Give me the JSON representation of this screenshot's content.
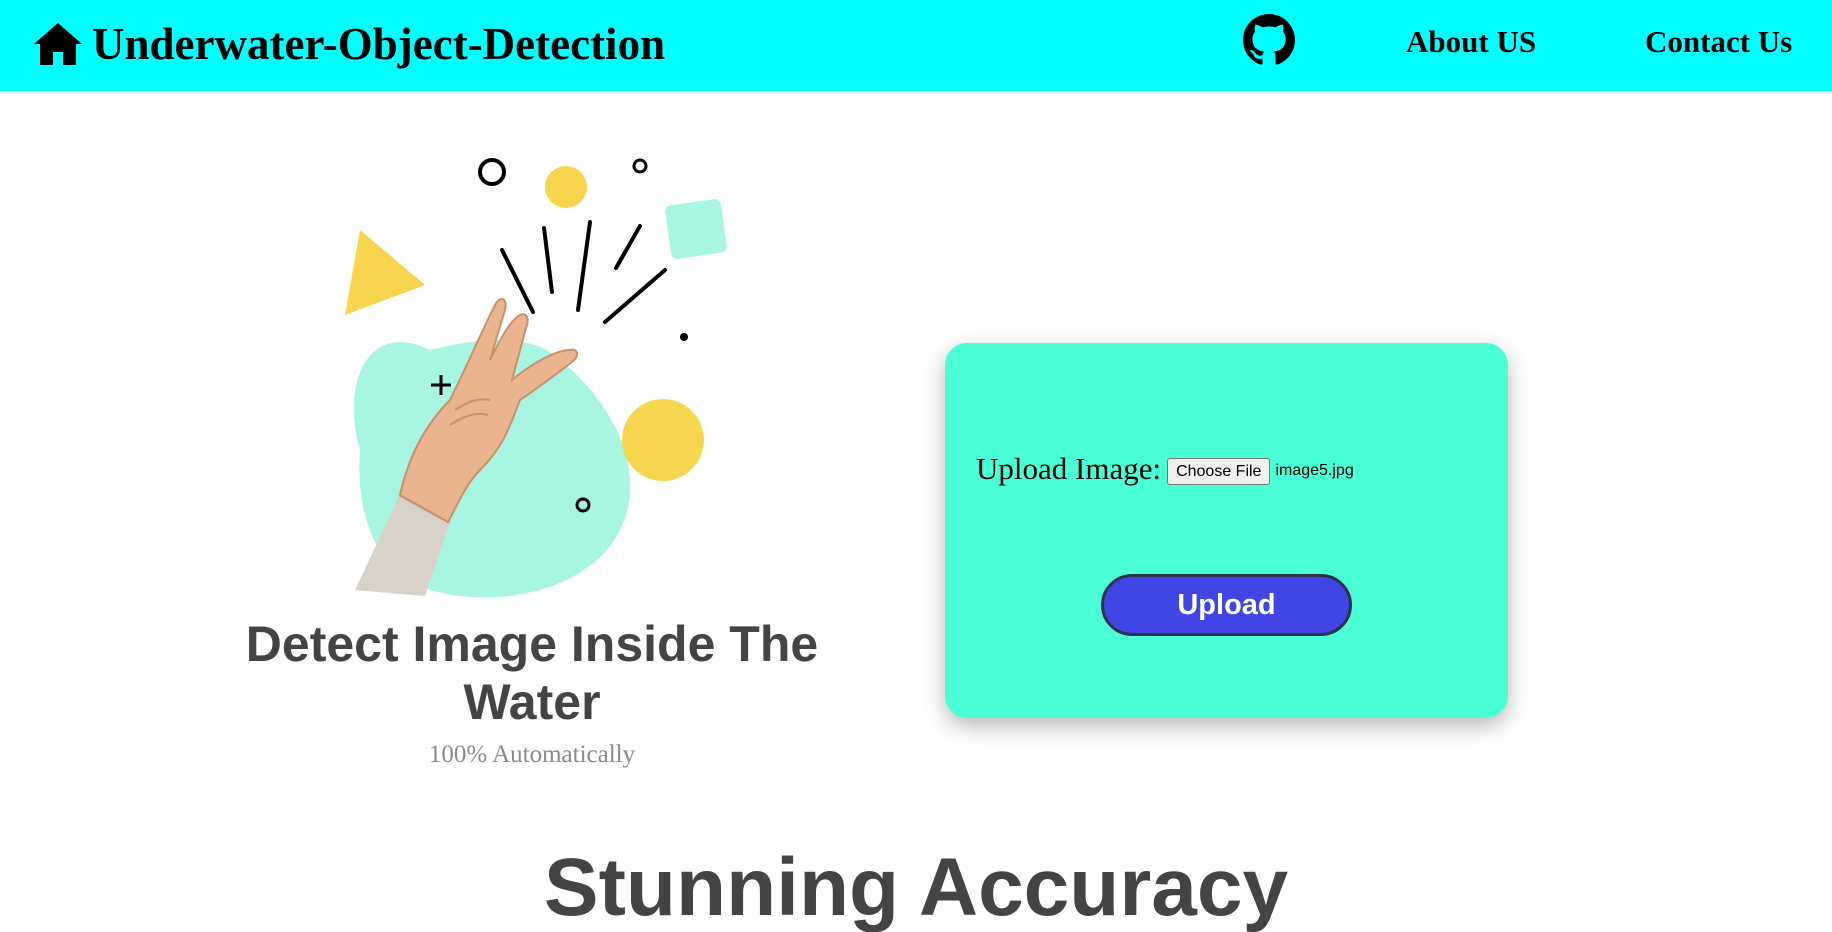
{
  "nav": {
    "brand": "Underwater-Object-Detection",
    "about": "About US",
    "contact": "Contact Us",
    "icons": [
      "home-icon",
      "github-icon"
    ],
    "bg_color": "#00ffff"
  },
  "hero": {
    "title": "Detect Image Inside The Water",
    "subtitle": "100% Automatically"
  },
  "upload": {
    "label": "Upload Image:",
    "choose_file": "Choose File",
    "file_name": "image5.jpg",
    "button": "Upload",
    "card_color": "#4affd6",
    "button_color": "#4046e6"
  },
  "section": {
    "title": "Stunning Accuracy"
  }
}
